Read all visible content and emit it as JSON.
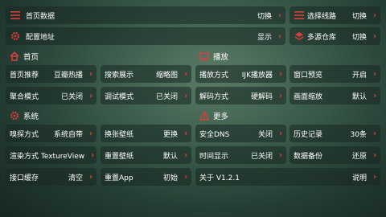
{
  "colors": {
    "accent": "#d84040",
    "panel_bg": "#182822",
    "text": "#ffffff"
  },
  "top": {
    "home_data": {
      "label": "首页数据",
      "value": "切换",
      "icon": "list-icon"
    },
    "select_line": {
      "label": "选择线路",
      "value": "切换",
      "icon": "list-icon"
    },
    "config_url": {
      "label": "配置地址",
      "value": "显示",
      "icon": "gear-icon"
    },
    "multi_repo": {
      "label": "多源仓库",
      "value": "切换",
      "icon": "layers-icon"
    }
  },
  "sections": {
    "home": {
      "title": "首页",
      "icon": "home-icon"
    },
    "play": {
      "title": "播放",
      "icon": "tv-icon"
    },
    "system": {
      "title": "系统",
      "icon": "gear-icon"
    },
    "more": {
      "title": "更多",
      "icon": "warning-icon"
    }
  },
  "home_items": {
    "recommend": {
      "label": "首页推荐",
      "value": "豆瓣热播"
    },
    "search_display": {
      "label": "搜索展示",
      "value": "缩略图"
    },
    "aggregate": {
      "label": "聚合模式",
      "value": "已关闭"
    },
    "debug": {
      "label": "调试模式",
      "value": "已关闭"
    }
  },
  "play_items": {
    "play_mode": {
      "label": "播放方式",
      "value": "IJK播放器"
    },
    "window_preview": {
      "label": "窗口预览",
      "value": "开启"
    },
    "decode": {
      "label": "解码方式",
      "value": "硬解码"
    },
    "scale": {
      "label": "画面缩放",
      "value": "默认"
    }
  },
  "system_items": {
    "sniff": {
      "label": "嗅探方式",
      "value": "系统自带"
    },
    "wallpaper_change": {
      "label": "换张壁纸",
      "value": "更换"
    },
    "render": {
      "label": "渲染方式 TextureView",
      "value": ""
    },
    "wallpaper_reset": {
      "label": "重置壁纸",
      "value": "默认"
    },
    "cache": {
      "label": "接口缓存",
      "value": "清空"
    },
    "reset_app": {
      "label": "重置App",
      "value": "初始"
    }
  },
  "more_items": {
    "secure_dns": {
      "label": "安全DNS",
      "value": "关闭"
    },
    "history": {
      "label": "历史记录",
      "value": "30条"
    },
    "time_display": {
      "label": "时间显示",
      "value": "已关闭"
    },
    "backup": {
      "label": "数据备份",
      "value": "还原"
    },
    "about": {
      "label": "关于  V1.2.1",
      "value": "说明"
    }
  }
}
